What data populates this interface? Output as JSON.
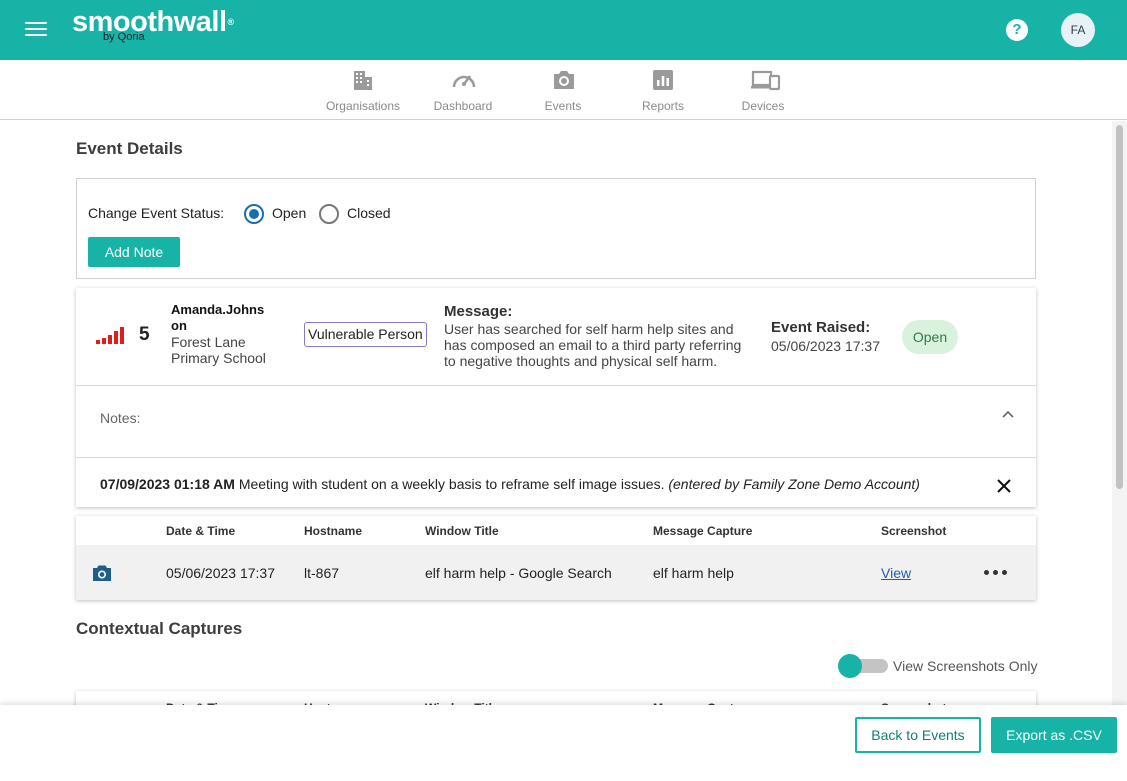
{
  "header": {
    "brand_name": "smoothwall",
    "brand_mark": "®",
    "brand_sub": "by Qoria",
    "help_icon": "?",
    "avatar_initials": "FA",
    "accent_color": "#17b3a7"
  },
  "nav": {
    "items": [
      {
        "label": "Organisations",
        "icon": "building-icon"
      },
      {
        "label": "Dashboard",
        "icon": "gauge-icon"
      },
      {
        "label": "Events",
        "icon": "camera-icon"
      },
      {
        "label": "Reports",
        "icon": "bar-chart-icon"
      },
      {
        "label": "Devices",
        "icon": "devices-icon"
      }
    ]
  },
  "event_details": {
    "title": "Event Details",
    "status_label": "Change Event Status:",
    "status_options": [
      "Open",
      "Closed"
    ],
    "selected_status": "Open",
    "add_note_label": "Add Note"
  },
  "event": {
    "severity": "5",
    "severity_icon": "severity-bars-icon",
    "user": "Amanda.Johns on",
    "organisation": "Forest Lane Primary School",
    "category": "Vulnerable Person",
    "message_heading": "Message:",
    "message": "User has searched for self harm help sites and has composed an email to a third party referring to negative thoughts and physical self harm.",
    "raised_heading": "Event Raised:",
    "raised_date": "05/06/2023 17:37",
    "status_badge": "Open"
  },
  "notes": {
    "label": "Notes:",
    "entries": [
      {
        "timestamp": "07/09/2023 01:18 AM",
        "text": "Meeting with student on a weekly basis to reframe self image issues.",
        "author": "(entered by Family Zone Demo Account)"
      }
    ]
  },
  "captures_table": {
    "headers": [
      "Date & Time",
      "Hostname",
      "Window Title",
      "Message Capture",
      "Screenshot"
    ],
    "rows": [
      {
        "date_time": "05/06/2023 17:37",
        "hostname": "lt-867",
        "window_title": "elf harm help - Google Search",
        "message_capture": "elf harm help",
        "screenshot": "View"
      }
    ]
  },
  "contextual": {
    "title": "Contextual Captures",
    "toggle_label": "View Screenshots Only",
    "toggle_on": false
  },
  "footer": {
    "back_label": "Back to Events",
    "export_label": "Export as .CSV"
  }
}
